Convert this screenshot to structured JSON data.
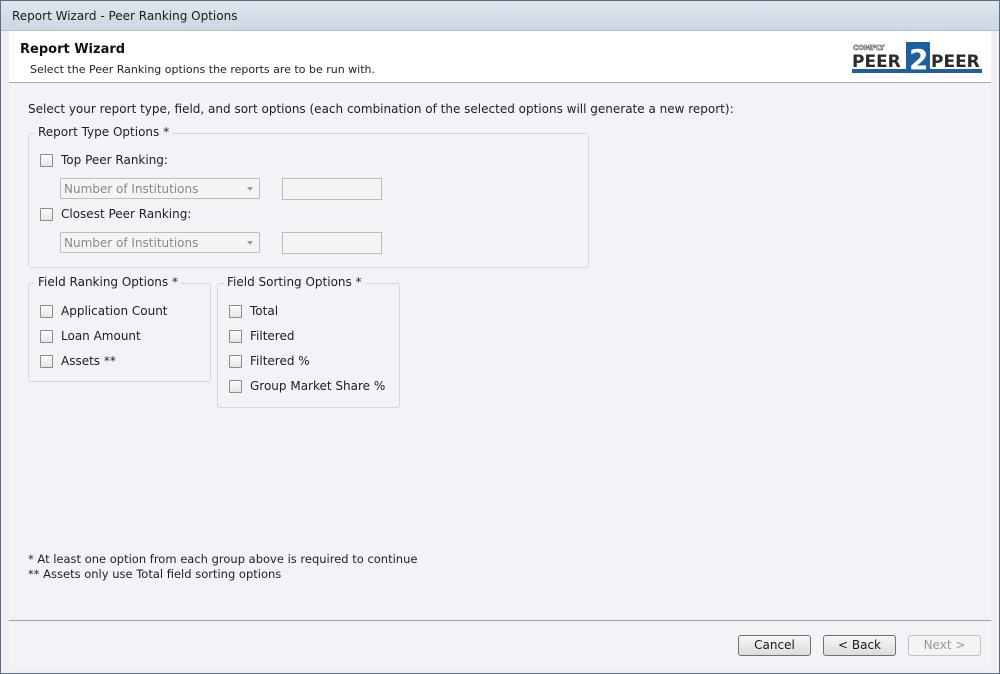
{
  "window": {
    "title": "Report Wizard - Peer Ranking Options"
  },
  "header": {
    "title": "Report Wizard",
    "subtitle": "Select the Peer Ranking options the reports are to be run with.",
    "logo": {
      "top": "COMPLY",
      "left": "PEER",
      "middle": "2",
      "right": "PEER"
    }
  },
  "intro": "Select your report type, field, and sort options (each combination of the selected options will generate a new report):",
  "report_type": {
    "legend": "Report Type Options *",
    "top": {
      "label": "Top Peer Ranking:",
      "checked": false,
      "combo": "Number of Institutions",
      "value": ""
    },
    "closest": {
      "label": "Closest Peer Ranking:",
      "checked": false,
      "combo": "Number of Institutions",
      "value": ""
    }
  },
  "field_ranking": {
    "legend": "Field Ranking Options *",
    "items": [
      "Application Count",
      "Loan Amount",
      "Assets **"
    ]
  },
  "field_sorting": {
    "legend": "Field Sorting Options *",
    "items": [
      "Total",
      "Filtered",
      "Filtered %",
      "Group Market Share %"
    ]
  },
  "notes": [
    "* At least one option from each group above is required to continue",
    "** Assets only use Total field sorting options"
  ],
  "buttons": {
    "cancel": "Cancel",
    "back": "< Back",
    "next": "Next >"
  },
  "colors": {
    "logo_blue": "#1f5f9f",
    "logo_dark": "#2b2b2b"
  }
}
